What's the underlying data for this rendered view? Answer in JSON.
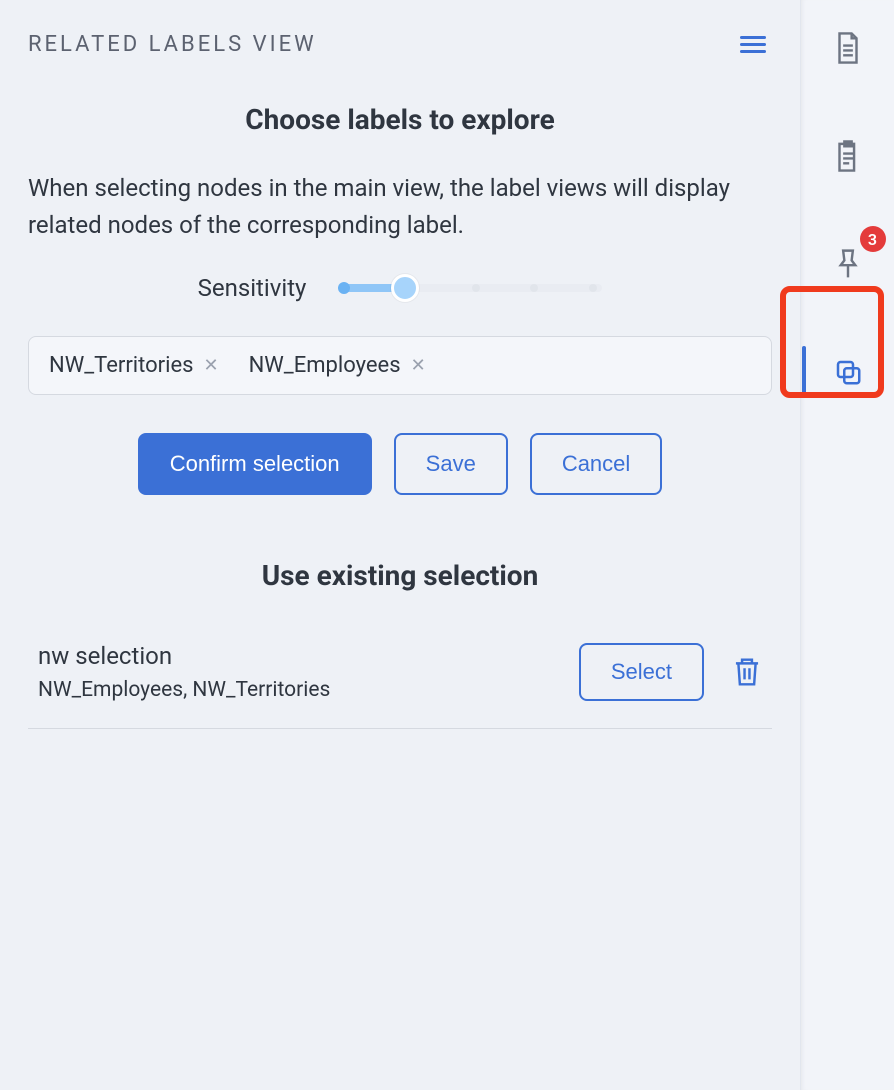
{
  "header": {
    "title": "RELATED LABELS VIEW"
  },
  "choose": {
    "title": "Choose labels to explore",
    "description": "When selecting nodes in the main view, the label views will display related nodes of the corresponding label.",
    "sensitivity_label": "Sensitivity"
  },
  "chips": [
    "NW_Territories",
    "NW_Employees"
  ],
  "buttons": {
    "confirm": "Confirm selection",
    "save": "Save",
    "cancel": "Cancel"
  },
  "existing": {
    "title": "Use existing selection",
    "items": [
      {
        "name": "nw selection",
        "labels": "NW_Employees, NW_Territories",
        "select_label": "Select"
      }
    ]
  },
  "sidebar": {
    "badge": "3"
  }
}
